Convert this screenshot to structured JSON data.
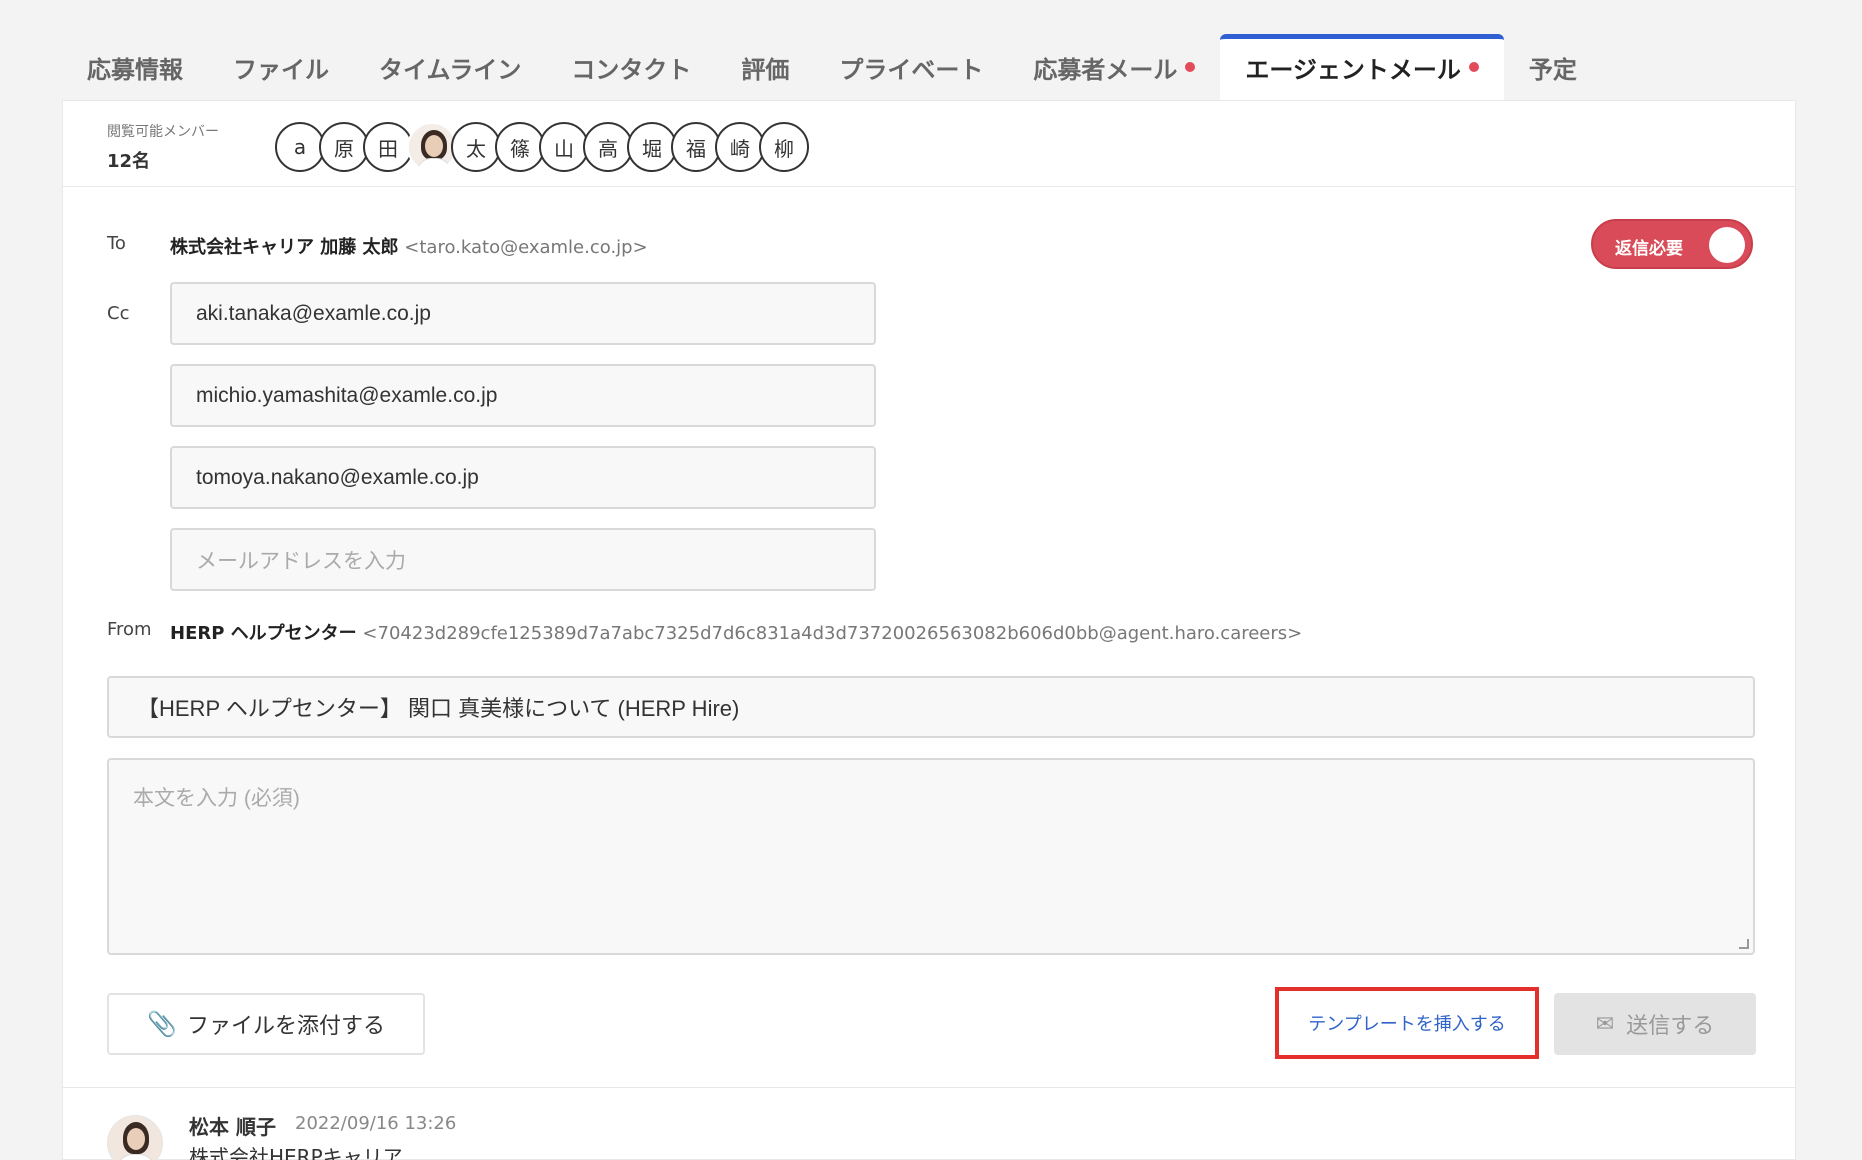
{
  "tabs": [
    {
      "label": "応募情報",
      "dot": false,
      "active": false
    },
    {
      "label": "ファイル",
      "dot": false,
      "active": false
    },
    {
      "label": "タイムライン",
      "dot": false,
      "active": false
    },
    {
      "label": "コンタクト",
      "dot": false,
      "active": false
    },
    {
      "label": "評価",
      "dot": false,
      "active": false
    },
    {
      "label": "プライベート",
      "dot": false,
      "active": false
    },
    {
      "label": "応募者メール",
      "dot": true,
      "active": false
    },
    {
      "label": "エージェントメール",
      "dot": true,
      "active": true
    },
    {
      "label": "予定",
      "dot": false,
      "active": false
    }
  ],
  "members": {
    "label": "閲覧可能メンバー",
    "count": "12名",
    "avatars": [
      "a",
      "原",
      "田",
      "",
      "太",
      "篠",
      "山",
      "高",
      "堀",
      "福",
      "崎",
      "柳"
    ]
  },
  "to": {
    "label": "To",
    "name": "株式会社キャリア 加藤 太郎",
    "address": "<taro.kato@examle.co.jp>"
  },
  "reply_toggle": {
    "label": "返信必要",
    "on": true
  },
  "cc": {
    "label": "Cc",
    "values": [
      "aki.tanaka@examle.co.jp",
      "michio.yamashita@examle.co.jp",
      "tomoya.nakano@examle.co.jp"
    ],
    "placeholder": "メールアドレスを入力"
  },
  "from": {
    "label": "From",
    "name": "HERP ヘルプセンター",
    "address": "<70423d289cfe125389d7a7abc7325d7d6c831a4d3d73720026563082b606d0bb@agent.haro.careers>"
  },
  "subject": "【HERP ヘルプセンター】 関口 真美様について (HERP Hire)",
  "body_placeholder": "本文を入力 (必須)",
  "actions": {
    "attach_label": "ファイルを添付する",
    "template_label": "テンプレートを挿入する",
    "send_label": "送信する"
  },
  "comment": {
    "name": "松本 順子",
    "time": "2022/09/16 13:26",
    "company": "株式会社HERPキャリア"
  },
  "colors": {
    "tab_active_accent": "#2f5fd3",
    "dot": "#e44b5a",
    "toggle_on": "#d94b58",
    "highlight_border": "#e3302c",
    "link": "#2f63c9"
  }
}
